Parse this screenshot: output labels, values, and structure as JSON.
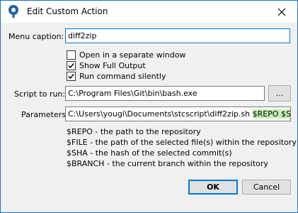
{
  "window": {
    "title": "Edit Custom Action"
  },
  "form": {
    "menu_caption_label": "Menu caption:",
    "menu_caption_value": "diff2zip",
    "checkboxes": [
      {
        "label": "Open in a separate window",
        "checked": false
      },
      {
        "label": "Show Full Output",
        "checked": true
      },
      {
        "label": "Run command silently",
        "checked": true
      }
    ],
    "script_label": "Script to run:",
    "script_value": "C:\\Program Files\\Git\\bin\\bash.exe",
    "browse_label": "...",
    "parameters_label": "Parameters",
    "parameters_value_plain": "C:\\Users\\yougi\\Documents\\stcscript\\diff2zip.sh ",
    "parameters_value_highlight": "$REPO $SH",
    "help": [
      "$REPO - the path to the repository",
      "$FILE - the path of the selected file(s) within the repository",
      "$SHA - the hash of the selected commit(s)",
      "$BRANCH - the current branch within the repository"
    ]
  },
  "buttons": {
    "ok": "OK",
    "cancel": "Cancel"
  },
  "colors": {
    "accent": "#0078d7",
    "highlight": "#c7f0b4"
  }
}
